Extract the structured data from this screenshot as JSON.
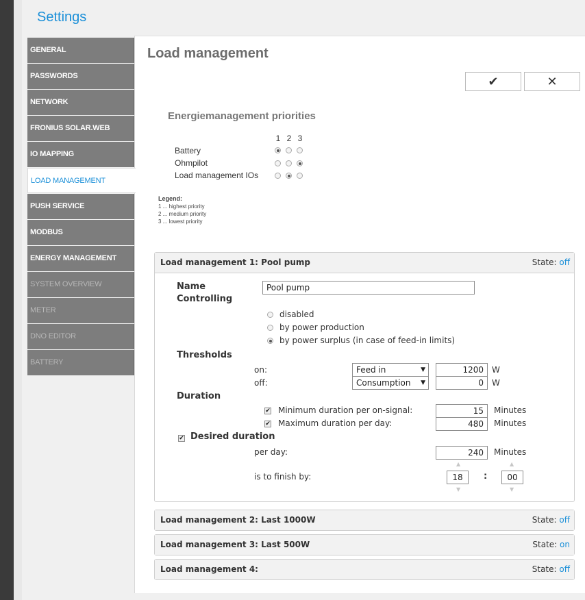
{
  "app": {
    "title": "Settings"
  },
  "sidebar": {
    "items": [
      {
        "label": "GENERAL"
      },
      {
        "label": "PASSWORDS"
      },
      {
        "label": "NETWORK"
      },
      {
        "label": "FRONIUS SOLAR.WEB"
      },
      {
        "label": "IO MAPPING"
      },
      {
        "label": "LOAD MANAGEMENT"
      },
      {
        "label": "PUSH SERVICE"
      },
      {
        "label": "MODBUS"
      },
      {
        "label": "ENERGY MANAGEMENT"
      },
      {
        "label": "SYSTEM OVERVIEW"
      },
      {
        "label": "METER"
      },
      {
        "label": "DNO EDITOR"
      },
      {
        "label": "BATTERY"
      }
    ],
    "active_index": 5
  },
  "main": {
    "title": "Load management",
    "confirm_icon": "check-icon",
    "confirm_glyph": "✔",
    "cancel_icon": "close-icon",
    "cancel_glyph": "✕"
  },
  "priorities": {
    "title": "Energiemanagement priorities",
    "columns": [
      "1",
      "2",
      "3"
    ],
    "rows": [
      {
        "label": "Battery",
        "selected": 1
      },
      {
        "label": "Ohmpilot",
        "selected": 3
      },
      {
        "label": "Load management IOs",
        "selected": 2
      }
    ],
    "legend_title": "Legend:",
    "legend": [
      "1 ... highest priority",
      "2 ... medium priority",
      "3 ... lowest priority"
    ]
  },
  "load_managements": [
    {
      "title": "Load management 1: Pool pump",
      "state_label": "State:",
      "state_value": "off",
      "expanded": true,
      "name_label": "Name",
      "name_value": "Pool pump",
      "controlling_label": "Controlling",
      "controlling_options": [
        "disabled",
        "by power production",
        "by power surplus (in case of feed-in limits)"
      ],
      "controlling_selected": 2,
      "thresholds_label": "Thresholds",
      "on_label": "on:",
      "on_mode": "Feed in",
      "on_value": "1200",
      "off_label": "off:",
      "off_mode": "Consumption",
      "off_value": "0",
      "unit_w": "W",
      "duration_label": "Duration",
      "min_duration_label": "Minimum duration per on-signal:",
      "min_duration_checked": true,
      "min_duration_value": "15",
      "max_duration_label": "Maximum duration per day:",
      "max_duration_checked": true,
      "max_duration_value": "480",
      "unit_minutes": "Minutes",
      "desired_label": "Desired duration",
      "desired_checked": true,
      "per_day_label": "per day:",
      "per_day_value": "240",
      "finish_label": "is to finish by:",
      "finish_hour": "18",
      "finish_separator": ":",
      "finish_minute": "00"
    },
    {
      "title": "Load management 2: Last 1000W",
      "state_label": "State:",
      "state_value": "off",
      "expanded": false
    },
    {
      "title": "Load management 3: Last 500W",
      "state_label": "State:",
      "state_value": "on",
      "expanded": false
    },
    {
      "title": "Load management 4:",
      "state_label": "State:",
      "state_value": "off",
      "expanded": false
    }
  ],
  "colors": {
    "accent": "#1a8fd8",
    "sidebar_bg": "#7d7d7d",
    "title_gray": "#6c6c6c"
  }
}
